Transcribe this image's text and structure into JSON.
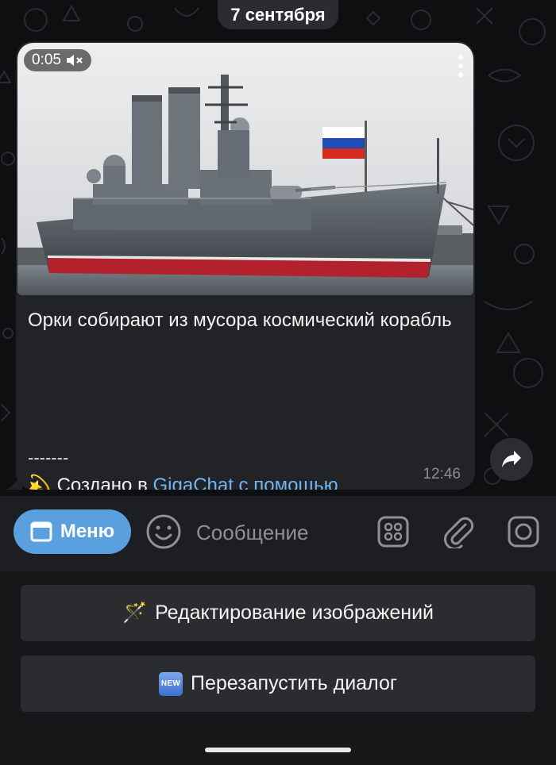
{
  "date_label": "7 сентября",
  "message": {
    "video_duration": "0:05",
    "muted_icon": "speaker-muted-icon",
    "caption": "Орки собирают из мусора космический корабль",
    "separator": "-------",
    "credit_emoji": "💫",
    "credit_prefix": "Создано в ",
    "credit_link": "GigaChat с помощью Kandinsky",
    "time": "12:46"
  },
  "input_bar": {
    "menu_label": "Меню",
    "placeholder": "Сообщение",
    "icons": [
      "emoji-icon",
      "apps-grid-icon",
      "paperclip-icon",
      "camera-icon"
    ]
  },
  "keyboard_buttons": [
    {
      "emoji": "🪄",
      "label": "Редактирование изображений"
    },
    {
      "badge": "NEW",
      "label": "Перезапустить диалог"
    }
  ],
  "colors": {
    "bubble": "#212326",
    "accent": "#5aa0df",
    "link": "#6fb6f2",
    "background": "#0e0f11"
  }
}
